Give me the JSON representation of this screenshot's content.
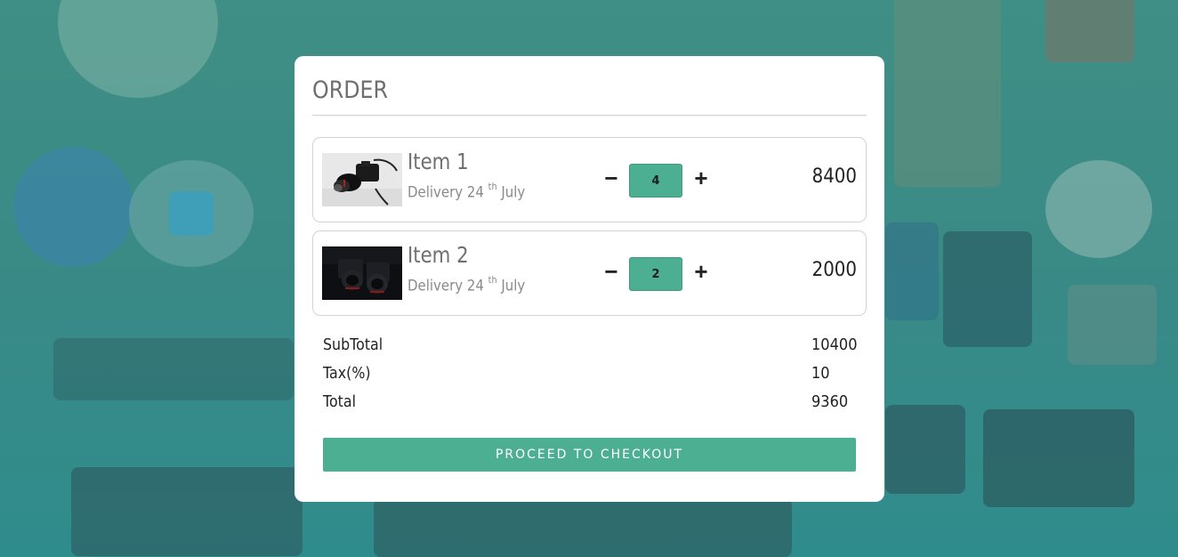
{
  "order": {
    "title": "ORDER",
    "items": [
      {
        "name": "Item 1",
        "delivery_prefix": "Delivery 24",
        "delivery_sup": "th",
        "delivery_suffix": "July",
        "quantity": "4",
        "price": "8400",
        "thumb_icon": "camera-image"
      },
      {
        "name": "Item 2",
        "delivery_prefix": "Delivery 24",
        "delivery_sup": "th",
        "delivery_suffix": "July",
        "quantity": "2",
        "price": "2000",
        "thumb_icon": "camera-image"
      }
    ],
    "controls": {
      "minus": "−",
      "plus": "+"
    },
    "summary": {
      "subtotal_label": "SubTotal",
      "subtotal_value": "10400",
      "tax_label": "Tax(%)",
      "tax_value": "10",
      "total_label": "Total",
      "total_value": "9360"
    },
    "checkout_label": "PROCEED TO CHECKOUT"
  },
  "colors": {
    "accent": "#4daf92",
    "background": "#3a8a86",
    "card": "#ffffff"
  }
}
